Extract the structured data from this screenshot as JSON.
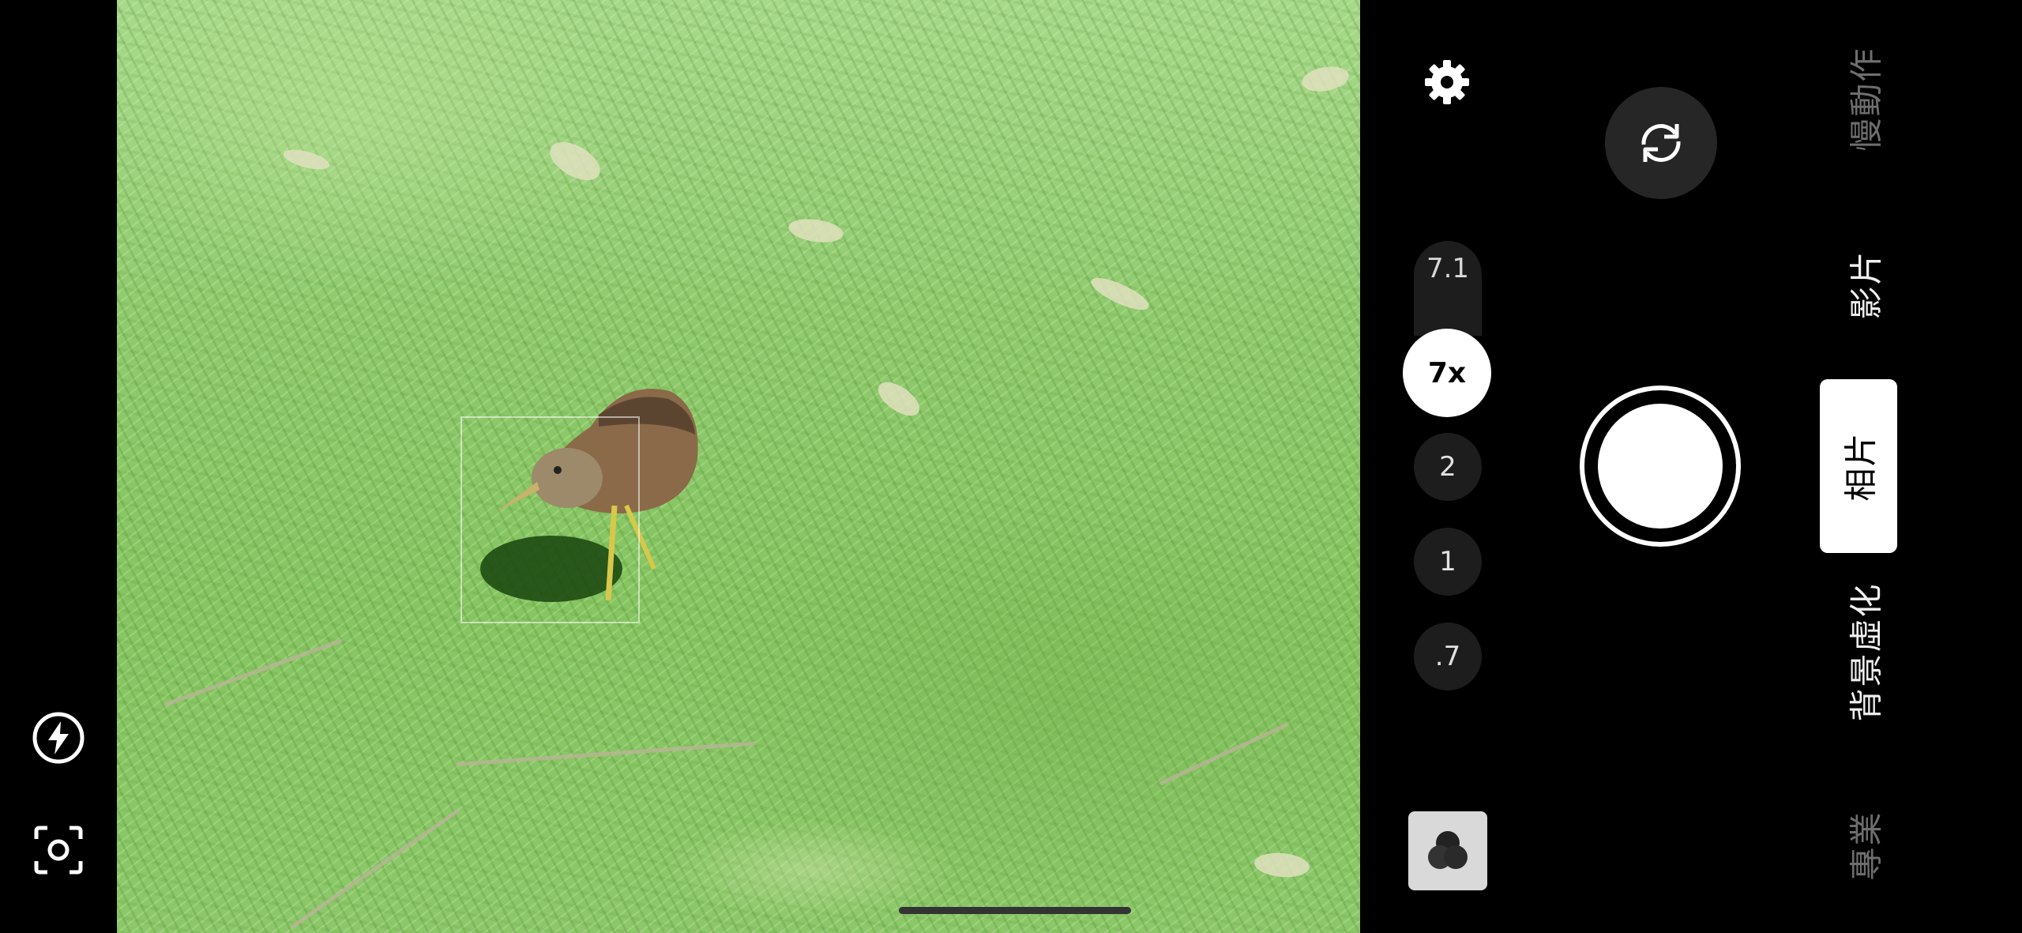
{
  "left_toolbar": {
    "flash_icon": "flash-auto-icon",
    "scan_icon": "lens-scan-icon"
  },
  "right_toolbar": {
    "settings_icon": "gear-icon",
    "switch_camera_icon": "rotate-camera-icon",
    "filter_icon": "color-filter-icon"
  },
  "zoom": {
    "current_value": "7.1",
    "active_label": "7x",
    "presets": [
      "2",
      "1",
      ".7"
    ]
  },
  "modes": {
    "slow_motion": "慢動作",
    "video": "影片",
    "photo": "相片",
    "portrait": "背景虛化",
    "pro": "專業"
  },
  "colors": {
    "accent": "#ffffff",
    "inactive_mode": "#6e6e6e",
    "button_bg": "#1d1d1d"
  }
}
